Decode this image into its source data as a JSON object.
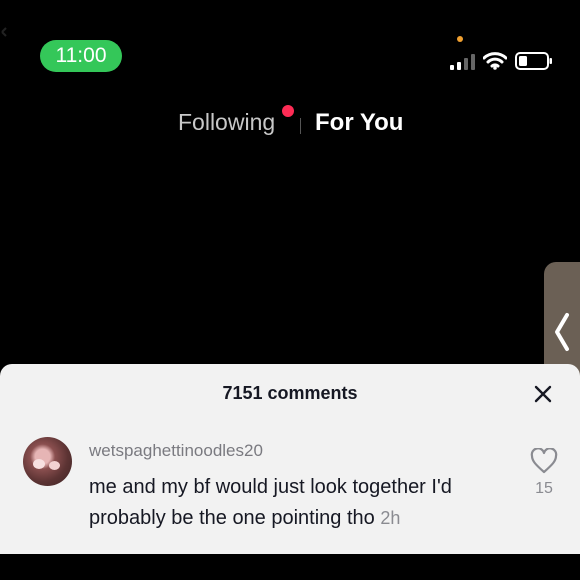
{
  "status_bar": {
    "time": "11:00",
    "colors": {
      "time_pill": "#34c759",
      "privacy_dot": "#f0a030"
    },
    "icons": [
      "signal-icon",
      "wifi-icon",
      "battery-icon"
    ]
  },
  "feed_tabs": {
    "following_label": "Following",
    "for_you_label": "For You",
    "notification_dot_color": "#fe2c55"
  },
  "side_handle": {
    "icon": "chevron-left-icon"
  },
  "comments_sheet": {
    "title": "7151 comments",
    "close_icon": "close-icon",
    "comments": [
      {
        "username": "wetspaghettinoodles20",
        "text": "me and my bf would just look together I'd probably be the one pointing tho",
        "time": "2h",
        "likes": "15"
      }
    ]
  }
}
